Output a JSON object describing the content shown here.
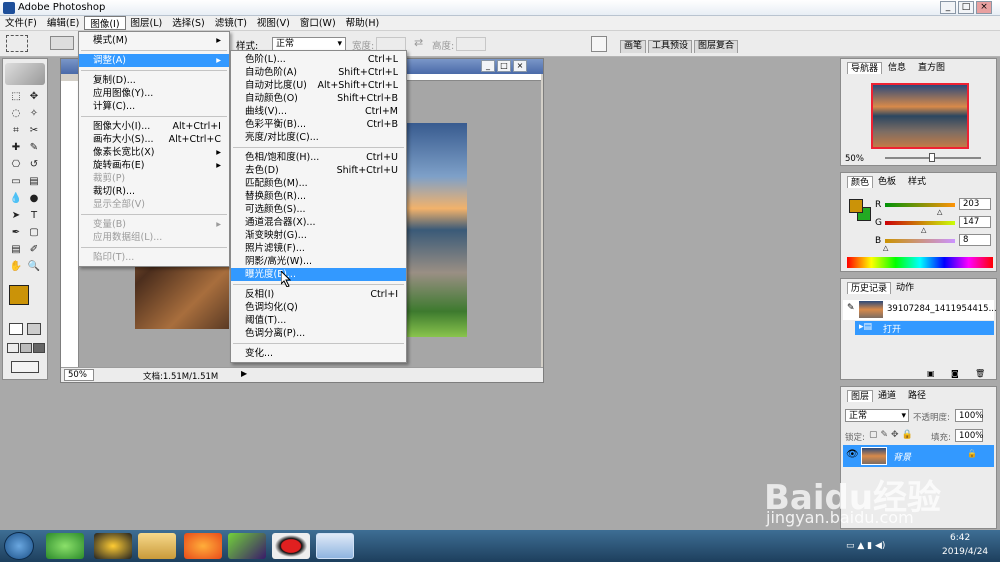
{
  "app": {
    "title": "Adobe Photoshop",
    "min": "_",
    "max": "□",
    "close": "×"
  },
  "menubar": [
    "文件(F)",
    "编辑(E)",
    "图像(I)",
    "图层(L)",
    "选择(S)",
    "滤镜(T)",
    "视图(V)",
    "窗口(W)",
    "帮助(H)"
  ],
  "options": {
    "style_label": "样式:",
    "style_value": "正常",
    "width_label": "宽度:",
    "height_label": "高度:",
    "tabs": [
      "画笔",
      "工具预设",
      "图层复合"
    ]
  },
  "image_menu": [
    {
      "label": "模式(M)",
      "sub": true
    },
    {
      "sep": true
    },
    {
      "label": "调整(A)",
      "sub": true,
      "highlight": true
    },
    {
      "sep": true
    },
    {
      "label": "复制(D)..."
    },
    {
      "label": "应用图像(Y)..."
    },
    {
      "label": "计算(C)..."
    },
    {
      "sep": true
    },
    {
      "label": "图像大小(I)...",
      "shortcut": "Alt+Ctrl+I"
    },
    {
      "label": "画布大小(S)...",
      "shortcut": "Alt+Ctrl+C"
    },
    {
      "label": "像素长宽比(X)",
      "sub": true
    },
    {
      "label": "旋转画布(E)",
      "sub": true
    },
    {
      "label": "裁剪(P)",
      "disabled": true
    },
    {
      "label": "裁切(R)..."
    },
    {
      "label": "显示全部(V)",
      "disabled": true
    },
    {
      "sep": true
    },
    {
      "label": "变量(B)",
      "disabled": true,
      "sub": true
    },
    {
      "label": "应用数据组(L)...",
      "disabled": true
    },
    {
      "sep": true
    },
    {
      "label": "陷印(T)...",
      "disabled": true
    }
  ],
  "adjust_menu": [
    {
      "label": "色阶(L)...",
      "shortcut": "Ctrl+L"
    },
    {
      "label": "自动色阶(A)",
      "shortcut": "Shift+Ctrl+L"
    },
    {
      "label": "自动对比度(U)",
      "shortcut": "Alt+Shift+Ctrl+L"
    },
    {
      "label": "自动颜色(O)",
      "shortcut": "Shift+Ctrl+B"
    },
    {
      "label": "曲线(V)...",
      "shortcut": "Ctrl+M"
    },
    {
      "label": "色彩平衡(B)...",
      "shortcut": "Ctrl+B"
    },
    {
      "label": "亮度/对比度(C)..."
    },
    {
      "sep": true
    },
    {
      "label": "色相/饱和度(H)...",
      "shortcut": "Ctrl+U"
    },
    {
      "label": "去色(D)",
      "shortcut": "Shift+Ctrl+U"
    },
    {
      "label": "匹配颜色(M)..."
    },
    {
      "label": "替换颜色(R)..."
    },
    {
      "label": "可选颜色(S)..."
    },
    {
      "label": "通道混合器(X)..."
    },
    {
      "label": "渐变映射(G)..."
    },
    {
      "label": "照片滤镜(F)..."
    },
    {
      "label": "阴影/高光(W)..."
    },
    {
      "label": "曝光度(E)...",
      "highlight": true
    },
    {
      "sep": true
    },
    {
      "label": "反相(I)",
      "shortcut": "Ctrl+I"
    },
    {
      "label": "色调均化(Q)"
    },
    {
      "label": "阈值(T)..."
    },
    {
      "label": "色调分离(P)..."
    },
    {
      "sep": true
    },
    {
      "label": "变化..."
    }
  ],
  "document": {
    "zoom": "50%",
    "status": "文档:1.51M/1.51M"
  },
  "navigator": {
    "tabs": [
      "导航器",
      "信息",
      "直方图"
    ],
    "zoom": "50%"
  },
  "color": {
    "tabs": [
      "颜色",
      "色板",
      "样式"
    ],
    "r_label": "R",
    "g_label": "G",
    "b_label": "B",
    "r": 203,
    "g": 147,
    "b": 8,
    "fg": "#cb9308",
    "bg": "#22aa22"
  },
  "history": {
    "tabs": [
      "历史记录",
      "动作"
    ],
    "snapshot": "39107284_1411954415...",
    "step": "打开"
  },
  "layers": {
    "tabs": [
      "图层",
      "通道",
      "路径"
    ],
    "mode": "正常",
    "opacity_label": "不透明度:",
    "opacity": "100%",
    "lock_label": "锁定:",
    "fill_label": "填充:",
    "fill": "100%",
    "layer_name": "背景"
  },
  "taskbar": {
    "time": "6:42",
    "date": "2019/4/24"
  },
  "watermark": {
    "brand": "Baidu经验",
    "url": "jingyan.baidu.com"
  }
}
